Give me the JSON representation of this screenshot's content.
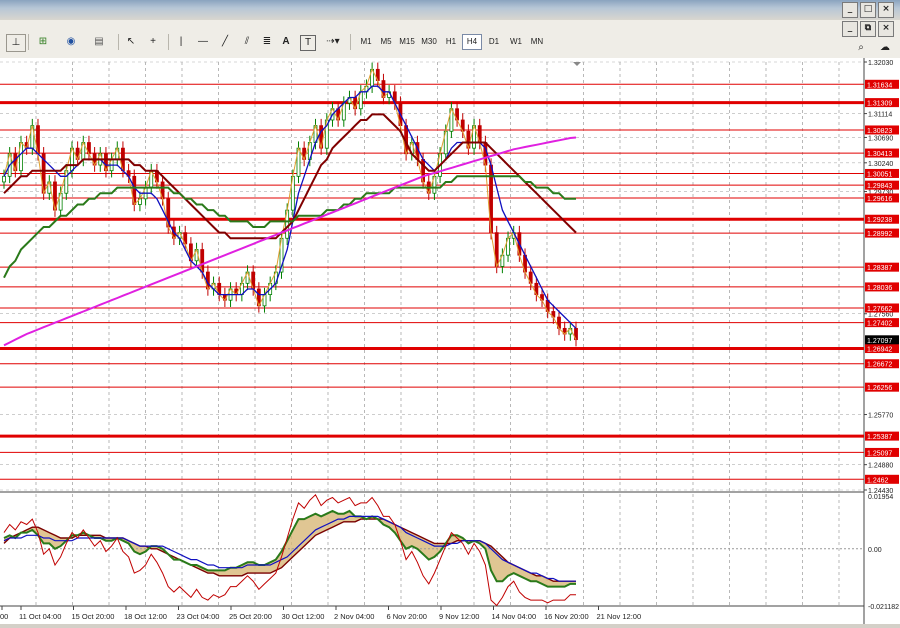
{
  "window": {
    "controls": [
      "_",
      "□",
      "×"
    ],
    "inner_controls": [
      "_",
      "⧉",
      "×"
    ]
  },
  "toolbar": {
    "icons": [
      "crosshair-period-icon",
      "new-chart-icon",
      "indicators-icon",
      "templates-icon",
      "cursor-icon",
      "crosshair-icon",
      "vertical-line-icon",
      "horizontal-line-icon",
      "trend-line-icon",
      "fibonacci-icon",
      "text-icon",
      "text-label-icon",
      "arrows-icon"
    ],
    "text_tool": "A",
    "label_tool": "T",
    "timeframes": [
      "M1",
      "M5",
      "M15",
      "M30",
      "H1",
      "H4",
      "D1",
      "W1",
      "MN"
    ],
    "active_timeframe": "H4"
  },
  "chart_data": {
    "type": "candlestick",
    "price_axis": {
      "range": [
        1.2443,
        1.3203
      ],
      "labels": [
        "1.32030",
        "1.31114",
        "1.30690",
        "1.30240",
        "1.29730",
        "1.27560",
        "1.25770",
        "1.24880",
        "1.24430"
      ],
      "levels": [
        1.3203,
        1.31114,
        1.3069,
        1.3024,
        1.2973,
        1.2756,
        1.2577,
        1.2488,
        1.2443
      ]
    },
    "horizontal_lines": [
      {
        "value": 1.31634,
        "label": "1.31634",
        "thick": false
      },
      {
        "value": 1.31309,
        "label": "1.31309",
        "thick": true
      },
      {
        "value": 1.30823,
        "label": "1.30823",
        "thick": false
      },
      {
        "value": 1.30413,
        "label": "1.30413",
        "thick": false
      },
      {
        "value": 1.30051,
        "label": "1.30051",
        "thick": false
      },
      {
        "value": 1.29843,
        "label": "1.29843",
        "thick": false
      },
      {
        "value": 1.29616,
        "label": "1.29616",
        "thick": false
      },
      {
        "value": 1.29238,
        "label": "1.29238",
        "thick": true
      },
      {
        "value": 1.28992,
        "label": "1.28992",
        "thick": false
      },
      {
        "value": 1.28387,
        "label": "1.28387",
        "thick": false
      },
      {
        "value": 1.28036,
        "label": "1.28036",
        "thick": false
      },
      {
        "value": 1.27662,
        "label": "1.27662",
        "thick": false
      },
      {
        "value": 1.27402,
        "label": "1.27402",
        "thick": false
      },
      {
        "value": 1.26942,
        "label": "1.26942",
        "thick": true
      },
      {
        "value": 1.26672,
        "label": "1.26672",
        "thick": false
      },
      {
        "value": 1.26256,
        "label": "1.26256",
        "thick": false
      },
      {
        "value": 1.25387,
        "label": "1.25387",
        "thick": true
      },
      {
        "value": 1.25097,
        "label": "1.25097",
        "thick": false
      },
      {
        "value": 1.2462,
        "label": "1.2462",
        "thick": false
      }
    ],
    "current_price": {
      "value": 1.27097,
      "label": "1.27097"
    },
    "close": [
      1.3,
      1.304,
      1.301,
      1.306,
      1.305,
      1.309,
      1.304,
      1.297,
      1.299,
      1.294,
      1.297,
      1.301,
      1.305,
      1.303,
      1.306,
      1.304,
      1.302,
      1.304,
      1.301,
      1.303,
      1.305,
      1.301,
      1.3,
      1.295,
      1.296,
      1.298,
      1.301,
      1.299,
      1.296,
      1.291,
      1.289,
      1.29,
      1.288,
      1.285,
      1.287,
      1.283,
      1.28,
      1.281,
      1.279,
      1.278,
      1.28,
      1.279,
      1.281,
      1.283,
      1.28,
      1.277,
      1.279,
      1.281,
      1.283,
      1.289,
      1.294,
      1.3,
      1.305,
      1.303,
      1.306,
      1.309,
      1.305,
      1.31,
      1.312,
      1.31,
      1.313,
      1.314,
      1.312,
      1.315,
      1.316,
      1.319,
      1.317,
      1.314,
      1.315,
      1.313,
      1.309,
      1.304,
      1.306,
      1.303,
      1.299,
      1.297,
      1.3,
      1.304,
      1.308,
      1.312,
      1.31,
      1.308,
      1.305,
      1.309,
      1.306,
      1.302,
      1.29,
      1.284,
      1.286,
      1.289,
      1.29,
      1.286,
      1.283,
      1.281,
      1.279,
      1.278,
      1.276,
      1.275,
      1.273,
      1.272,
      1.273,
      1.271
    ],
    "moving_averages": [
      {
        "color": "#1010c0",
        "values": [
          1.3,
          1.302,
          1.303,
          1.304,
          1.305,
          1.305,
          1.304,
          1.303,
          1.302,
          1.301,
          1.3,
          1.3,
          1.301,
          1.302,
          1.303,
          1.303,
          1.303,
          1.303,
          1.302,
          1.302,
          1.302,
          1.301,
          1.3,
          1.298,
          1.297,
          1.297,
          1.297,
          1.296,
          1.294,
          1.292,
          1.29,
          1.289,
          1.287,
          1.285,
          1.284,
          1.283,
          1.281,
          1.28,
          1.279,
          1.279,
          1.279,
          1.279,
          1.279,
          1.28,
          1.28,
          1.279,
          1.279,
          1.28,
          1.281,
          1.284,
          1.287,
          1.292,
          1.297,
          1.3,
          1.303,
          1.306,
          1.308,
          1.309,
          1.311,
          1.312,
          1.313,
          1.314,
          1.314,
          1.315,
          1.315,
          1.316,
          1.316,
          1.315,
          1.315,
          1.313,
          1.311,
          1.309,
          1.307,
          1.305,
          1.303,
          1.302,
          1.301,
          1.302,
          1.303,
          1.305,
          1.306,
          1.306,
          1.306,
          1.306,
          1.306,
          1.305,
          1.302,
          1.298,
          1.294,
          1.292,
          1.29,
          1.288,
          1.286,
          1.284,
          1.282,
          1.28,
          1.278,
          1.277,
          1.276,
          1.275,
          1.274,
          1.273
        ]
      },
      {
        "color": "#800000",
        "values": [
          1.297,
          1.298,
          1.299,
          1.3,
          1.3,
          1.301,
          1.301,
          1.301,
          1.301,
          1.301,
          1.301,
          1.302,
          1.302,
          1.302,
          1.303,
          1.303,
          1.303,
          1.303,
          1.303,
          1.303,
          1.303,
          1.303,
          1.303,
          1.302,
          1.302,
          1.301,
          1.301,
          1.301,
          1.3,
          1.299,
          1.298,
          1.297,
          1.296,
          1.295,
          1.294,
          1.293,
          1.292,
          1.291,
          1.29,
          1.29,
          1.289,
          1.289,
          1.289,
          1.289,
          1.289,
          1.289,
          1.289,
          1.289,
          1.289,
          1.29,
          1.291,
          1.292,
          1.294,
          1.296,
          1.298,
          1.3,
          1.302,
          1.303,
          1.305,
          1.306,
          1.307,
          1.308,
          1.309,
          1.31,
          1.31,
          1.311,
          1.311,
          1.311,
          1.31,
          1.309,
          1.308,
          1.306,
          1.304,
          1.303,
          1.302,
          1.301,
          1.301,
          1.302,
          1.303,
          1.304,
          1.305,
          1.306,
          1.306,
          1.306,
          1.306,
          1.306,
          1.305,
          1.304,
          1.303,
          1.302,
          1.301,
          1.3,
          1.299,
          1.298,
          1.297,
          1.296,
          1.295,
          1.294,
          1.293,
          1.292,
          1.291,
          1.29
        ]
      },
      {
        "color": "#2a7a1a",
        "values": [
          1.282,
          1.284,
          1.285,
          1.287,
          1.288,
          1.289,
          1.29,
          1.291,
          1.291,
          1.292,
          1.293,
          1.293,
          1.294,
          1.295,
          1.295,
          1.296,
          1.296,
          1.297,
          1.297,
          1.297,
          1.298,
          1.298,
          1.298,
          1.298,
          1.298,
          1.298,
          1.298,
          1.298,
          1.298,
          1.298,
          1.297,
          1.297,
          1.296,
          1.296,
          1.295,
          1.295,
          1.294,
          1.294,
          1.293,
          1.293,
          1.292,
          1.292,
          1.292,
          1.292,
          1.291,
          1.291,
          1.291,
          1.292,
          1.292,
          1.292,
          1.292,
          1.292,
          1.293,
          1.293,
          1.293,
          1.293,
          1.293,
          1.294,
          1.294,
          1.294,
          1.295,
          1.295,
          1.296,
          1.296,
          1.297,
          1.297,
          1.297,
          1.297,
          1.297,
          1.298,
          1.298,
          1.298,
          1.298,
          1.298,
          1.298,
          1.298,
          1.298,
          1.298,
          1.299,
          1.299,
          1.3,
          1.3,
          1.3,
          1.3,
          1.3,
          1.3,
          1.3,
          1.3,
          1.3,
          1.3,
          1.3,
          1.3,
          1.299,
          1.299,
          1.298,
          1.298,
          1.298,
          1.297,
          1.297,
          1.296,
          1.296,
          1.296
        ]
      },
      {
        "color": "#e020e0",
        "values": [
          1.27,
          1.2705,
          1.271,
          1.2715,
          1.272,
          1.2724,
          1.2728,
          1.2732,
          1.2736,
          1.274,
          1.2744,
          1.2748,
          1.2752,
          1.2756,
          1.276,
          1.2764,
          1.2768,
          1.2772,
          1.2776,
          1.278,
          1.2784,
          1.2788,
          1.2792,
          1.2796,
          1.28,
          1.2804,
          1.2808,
          1.2812,
          1.2816,
          1.282,
          1.2824,
          1.2828,
          1.2832,
          1.2836,
          1.284,
          1.2844,
          1.2848,
          1.2852,
          1.2856,
          1.286,
          1.2864,
          1.2868,
          1.2872,
          1.2876,
          1.288,
          1.2884,
          1.2888,
          1.2892,
          1.2896,
          1.29,
          1.2904,
          1.2908,
          1.2912,
          1.2916,
          1.292,
          1.2924,
          1.2928,
          1.2932,
          1.2936,
          1.294,
          1.2944,
          1.2948,
          1.2952,
          1.2956,
          1.296,
          1.2964,
          1.2968,
          1.2972,
          1.2976,
          1.298,
          1.2984,
          1.2988,
          1.2992,
          1.2996,
          1.3,
          1.3003,
          1.3006,
          1.3009,
          1.3012,
          1.3015,
          1.3018,
          1.3021,
          1.3024,
          1.3027,
          1.303,
          1.3033,
          1.3036,
          1.3039,
          1.3042,
          1.3045,
          1.3048,
          1.305,
          1.3052,
          1.3054,
          1.3056,
          1.3058,
          1.306,
          1.3062,
          1.3064,
          1.3066,
          1.3068,
          1.3069
        ]
      }
    ],
    "oscillator": {
      "range": [
        -0.021182,
        0.01954
      ],
      "labels": [
        "0.01954",
        "0.00",
        "-0.021182"
      ],
      "levels": [
        0.01954,
        0,
        -0.021182
      ],
      "main": [
        0.004,
        0.005,
        0.004,
        0.006,
        0.006,
        0.007,
        0.005,
        0.002,
        0.002,
        0.0,
        0.001,
        0.003,
        0.005,
        0.005,
        0.006,
        0.005,
        0.004,
        0.004,
        0.003,
        0.003,
        0.004,
        0.003,
        0.002,
        -0.001,
        -0.002,
        -0.001,
        0.001,
        0.001,
        0.0,
        -0.002,
        -0.004,
        -0.004,
        -0.005,
        -0.006,
        -0.006,
        -0.007,
        -0.008,
        -0.008,
        -0.008,
        -0.008,
        -0.007,
        -0.007,
        -0.006,
        -0.005,
        -0.005,
        -0.006,
        -0.006,
        -0.005,
        -0.004,
        -0.001,
        0.003,
        0.007,
        0.011,
        0.011,
        0.012,
        0.013,
        0.012,
        0.013,
        0.014,
        0.013,
        0.013,
        0.014,
        0.012,
        0.012,
        0.011,
        0.012,
        0.011,
        0.009,
        0.008,
        0.006,
        0.003,
        0.0,
        0.001,
        0.0,
        -0.002,
        -0.004,
        -0.003,
        -0.001,
        0.002,
        0.005,
        0.005,
        0.004,
        0.002,
        0.003,
        0.002,
        0.0,
        -0.008,
        -0.012,
        -0.012,
        -0.01,
        -0.009,
        -0.01,
        -0.011,
        -0.012,
        -0.012,
        -0.013,
        -0.014,
        -0.014,
        -0.014,
        -0.014,
        -0.013,
        -0.013
      ],
      "signal": [
        0.003,
        0.004,
        0.004,
        0.004,
        0.005,
        0.005,
        0.005,
        0.004,
        0.004,
        0.003,
        0.003,
        0.003,
        0.003,
        0.004,
        0.004,
        0.004,
        0.004,
        0.004,
        0.004,
        0.004,
        0.004,
        0.004,
        0.003,
        0.002,
        0.001,
        0.001,
        0.001,
        0.001,
        0.001,
        0.0,
        -0.001,
        -0.002,
        -0.003,
        -0.004,
        -0.004,
        -0.005,
        -0.006,
        -0.006,
        -0.007,
        -0.007,
        -0.007,
        -0.007,
        -0.007,
        -0.006,
        -0.006,
        -0.006,
        -0.006,
        -0.006,
        -0.005,
        -0.004,
        -0.003,
        -0.001,
        0.001,
        0.003,
        0.005,
        0.007,
        0.008,
        0.009,
        0.01,
        0.011,
        0.011,
        0.012,
        0.012,
        0.012,
        0.012,
        0.012,
        0.012,
        0.011,
        0.01,
        0.009,
        0.008,
        0.006,
        0.005,
        0.004,
        0.003,
        0.002,
        0.001,
        0.001,
        0.001,
        0.002,
        0.002,
        0.003,
        0.003,
        0.003,
        0.003,
        0.002,
        0.0,
        -0.002,
        -0.004,
        -0.005,
        -0.006,
        -0.007,
        -0.008,
        -0.009,
        -0.009,
        -0.01,
        -0.011,
        -0.011,
        -0.012,
        -0.012,
        -0.012,
        -0.012
      ],
      "fast": [
        0.006,
        0.009,
        0.007,
        0.01,
        0.009,
        0.011,
        0.006,
        -0.002,
        0.0,
        -0.006,
        -0.003,
        0.002,
        0.006,
        0.004,
        0.007,
        0.004,
        0.001,
        0.003,
        -0.001,
        0.001,
        0.004,
        -0.001,
        -0.003,
        -0.009,
        -0.008,
        -0.006,
        -0.002,
        -0.005,
        -0.009,
        -0.014,
        -0.016,
        -0.014,
        -0.016,
        -0.018,
        -0.015,
        -0.018,
        -0.019,
        -0.017,
        -0.018,
        -0.017,
        -0.014,
        -0.014,
        -0.012,
        -0.01,
        -0.012,
        -0.015,
        -0.013,
        -0.011,
        -0.009,
        -0.003,
        0.004,
        0.011,
        0.017,
        0.015,
        0.018,
        0.02,
        0.016,
        0.018,
        0.019,
        0.017,
        0.018,
        0.019,
        0.016,
        0.017,
        0.017,
        0.019,
        0.016,
        0.012,
        0.012,
        0.009,
        0.003,
        -0.004,
        -0.001,
        -0.005,
        -0.01,
        -0.013,
        -0.009,
        -0.004,
        0.001,
        0.006,
        0.004,
        0.002,
        -0.002,
        0.002,
        -0.001,
        -0.006,
        -0.019,
        -0.021,
        -0.018,
        -0.014,
        -0.012,
        -0.016,
        -0.018,
        -0.019,
        -0.019,
        -0.019,
        -0.02,
        -0.019,
        -0.019,
        -0.019,
        -0.017,
        -0.017
      ],
      "slow": [
        0.002,
        0.004,
        0.005,
        0.006,
        0.007,
        0.008,
        0.008,
        0.007,
        0.006,
        0.005,
        0.004,
        0.004,
        0.004,
        0.005,
        0.005,
        0.005,
        0.005,
        0.005,
        0.004,
        0.004,
        0.004,
        0.004,
        0.003,
        0.002,
        0.001,
        0.001,
        0.0,
        0.0,
        -0.001,
        -0.002,
        -0.003,
        -0.004,
        -0.005,
        -0.006,
        -0.007,
        -0.008,
        -0.009,
        -0.009,
        -0.01,
        -0.01,
        -0.01,
        -0.01,
        -0.01,
        -0.009,
        -0.009,
        -0.009,
        -0.009,
        -0.009,
        -0.008,
        -0.007,
        -0.005,
        -0.003,
        -0.001,
        0.001,
        0.003,
        0.005,
        0.006,
        0.007,
        0.008,
        0.009,
        0.01,
        0.01,
        0.01,
        0.011,
        0.011,
        0.011,
        0.011,
        0.011,
        0.01,
        0.009,
        0.008,
        0.007,
        0.006,
        0.005,
        0.004,
        0.003,
        0.002,
        0.002,
        0.002,
        0.002,
        0.003,
        0.003,
        0.003,
        0.003,
        0.003,
        0.002,
        0.001,
        -0.001,
        -0.003,
        -0.005,
        -0.006,
        -0.007,
        -0.008,
        -0.009,
        -0.01,
        -0.01,
        -0.011,
        -0.012,
        -0.012,
        -0.012,
        -0.012,
        -0.012
      ]
    },
    "time_labels": [
      "00",
      "11 Oct 04:00",
      "15 Oct 20:00",
      "18 Oct 12:00",
      "23 Oct 04:00",
      "25 Oct 20:00",
      "30 Oct 12:00",
      "2 Nov 04:00",
      "6 Nov 20:00",
      "9 Nov 12:00",
      "14 Nov 04:00",
      "16 Nov 20:00",
      "21 Nov 12:00"
    ],
    "grid": true,
    "colors": {
      "level_line": "#e00000",
      "bull": "#008000",
      "bear": "#c00000",
      "price_label_bg": "#e00000",
      "current_label_bg": "#000000",
      "fill": "#d8b878"
    }
  }
}
